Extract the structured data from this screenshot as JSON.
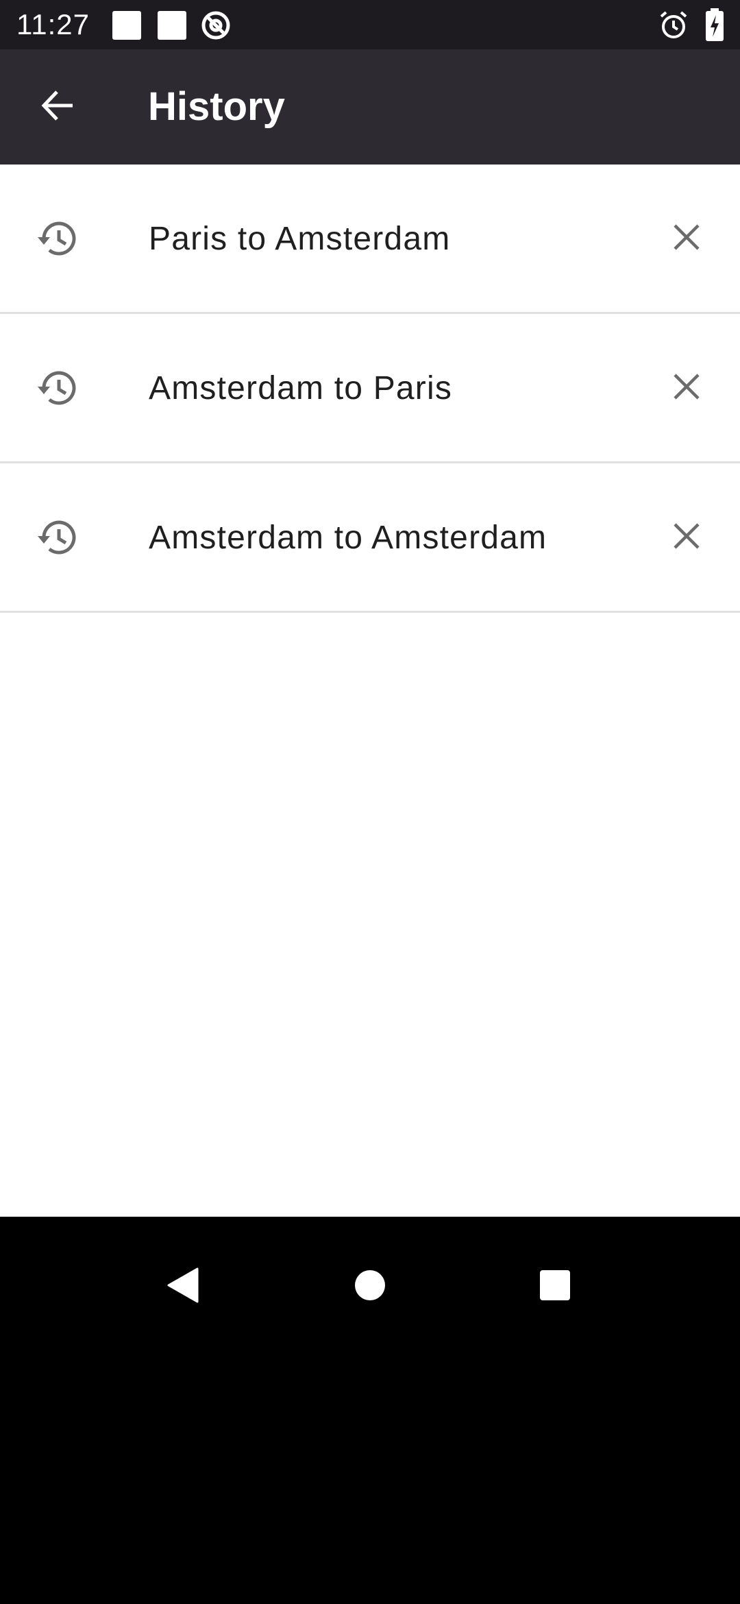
{
  "status_bar": {
    "time": "11:27",
    "icons": [
      "notification-square-icon",
      "notification-square-icon",
      "at-sign-icon",
      "alarm-icon",
      "battery-charging-icon"
    ]
  },
  "app_bar": {
    "title": "History",
    "back_icon": "arrow-back-icon"
  },
  "history": {
    "items": [
      {
        "label": "Paris to Amsterdam",
        "icon": "history-icon",
        "remove_icon": "close-icon"
      },
      {
        "label": "Amsterdam to Paris",
        "icon": "history-icon",
        "remove_icon": "close-icon"
      },
      {
        "label": "Amsterdam to Amsterdam",
        "icon": "history-icon",
        "remove_icon": "close-icon"
      }
    ]
  },
  "nav_bar": {
    "icons": [
      "nav-back-icon",
      "nav-home-icon",
      "nav-recents-icon"
    ]
  },
  "colors": {
    "status_bar_bg": "#1d1b20",
    "app_bar_bg": "#2d2a31",
    "content_bg": "#ffffff",
    "divider": "#e0e0e0",
    "icon_gray": "#6b6b6b",
    "text": "#1f1f1f"
  }
}
